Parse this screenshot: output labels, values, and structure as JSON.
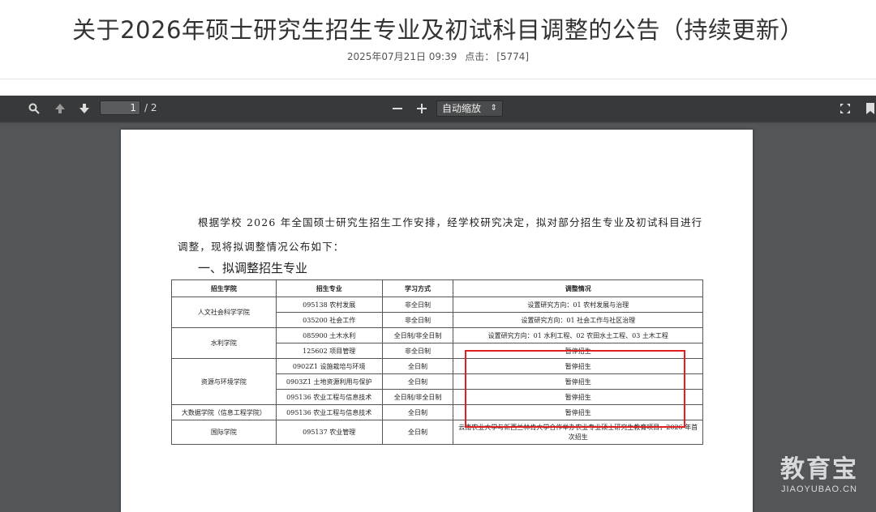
{
  "article": {
    "title": "关于2026年硕士研究生招生专业及初试科目调整的公告（持续更新）",
    "date": "2025年07月21日 09:39",
    "clicks_label": "点击：",
    "clicks_value": "[5774]"
  },
  "toolbar": {
    "page_current": "1",
    "page_total": "/ 2",
    "zoom_label": "自动缩放"
  },
  "document": {
    "paragraph": "根据学校 2026 年全国硕士研究生招生工作安排，经学校研究决定，拟对部分招生专业及初试科目进行调整，现将拟调整情况公布如下：",
    "section_title": "一、拟调整招生专业",
    "table": {
      "headers": [
        "招生学院",
        "招生专业",
        "学习方式",
        "调整情况"
      ],
      "rows": [
        {
          "college": "人文社会科学学院",
          "major": "095138 农村发展",
          "mode": "非全日制",
          "change": "设置研究方向：01 农村发展与治理"
        },
        {
          "college": "",
          "major": "035200 社会工作",
          "mode": "非全日制",
          "change": "设置研究方向：01 社会工作与社区治理"
        },
        {
          "college": "水利学院",
          "major": "085900 土木水利",
          "mode": "全日制/非全日制",
          "change": "设置研究方向：01 水利工程、02 农田水土工程、03 土木工程"
        },
        {
          "college": "",
          "major": "125602 项目管理",
          "mode": "非全日制",
          "change": "暂停招生"
        },
        {
          "college": "资源与环境学院",
          "major": "0902Z1 设施栽培与环境",
          "mode": "全日制",
          "change": "暂停招生"
        },
        {
          "college": "",
          "major": "0903Z1 土地资源利用与保护",
          "mode": "全日制",
          "change": "暂停招生"
        },
        {
          "college": "",
          "major": "095136 农业工程与信息技术",
          "mode": "全日制/非全日制",
          "change": "暂停招生"
        },
        {
          "college": "大数据学院（信息工程学院）",
          "major": "095136 农业工程与信息技术",
          "mode": "全日制",
          "change": "暂停招生"
        },
        {
          "college": "国际学院",
          "major": "095137 农业管理",
          "mode": "全日制",
          "change": "云南农业大学与新西兰林肯大学合作举办农业专业硕士研究生教育项目，2026 年首次招生"
        }
      ]
    }
  },
  "watermark": {
    "cn": "教育宝",
    "en": "JIAOYUBAO.CN"
  }
}
